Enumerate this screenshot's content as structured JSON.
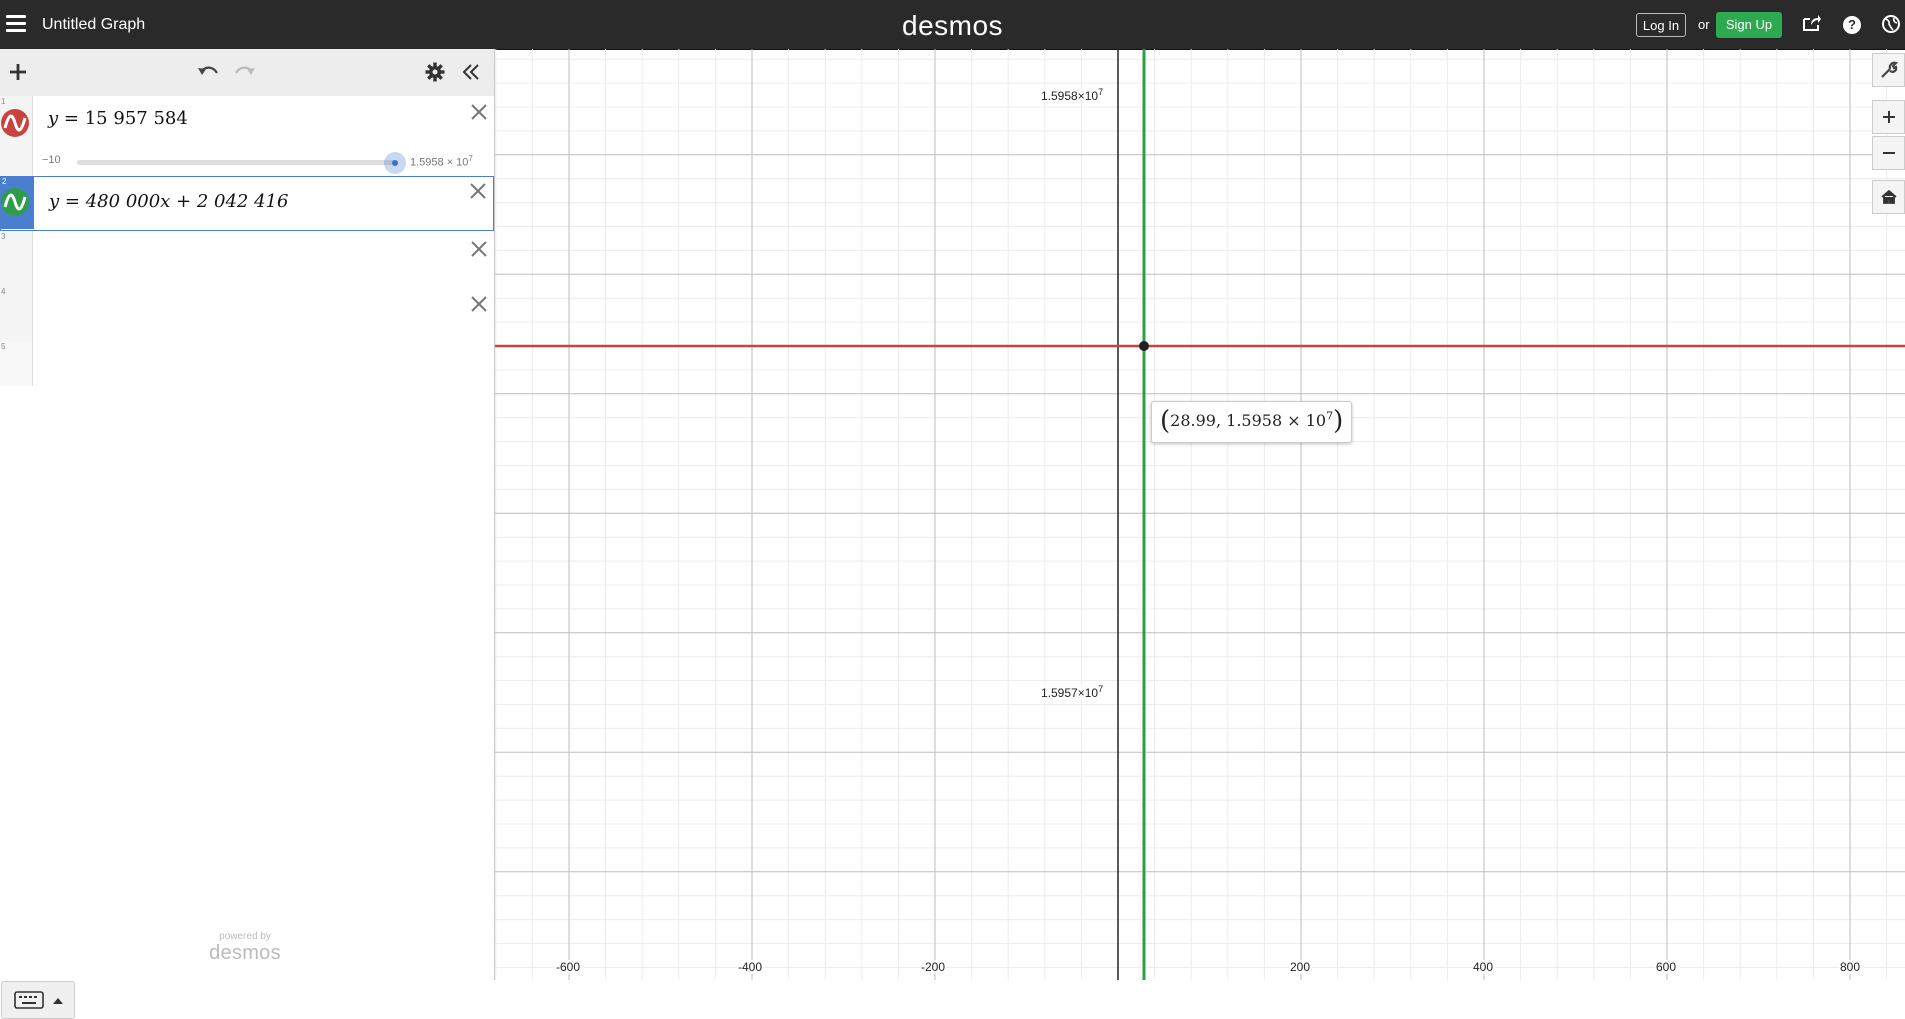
{
  "app": {
    "graph_title": "Untitled Graph",
    "logo": "desmos",
    "login_label": "Log In",
    "or_label": "or",
    "signup_label": "Sign Up"
  },
  "icons": {
    "menu": "hamburger-menu-icon",
    "share": "share-icon",
    "help": "help-icon",
    "language": "globe-icon",
    "add": "plus-icon",
    "undo": "undo-icon",
    "redo": "redo-icon",
    "settings": "gear-icon",
    "collapse": "double-chevron-left-icon",
    "graph_settings": "wrench-icon",
    "zoom_in": "plus-icon",
    "zoom_out": "minus-icon",
    "home": "home-icon",
    "keyboard": "keyboard-icon"
  },
  "colors": {
    "red": "#c74440",
    "green": "#2d9d4b",
    "blue_select": "#4a7fd0",
    "topbar": "#2a2a2a",
    "signup": "#2da94f"
  },
  "expressions": [
    {
      "number": "1",
      "lhs": "y",
      "eq": "=",
      "rhs": "15 957 584",
      "color": "#c74440",
      "slider": {
        "min": "−10",
        "max_mantissa": "1.5958 × 10",
        "max_exp": "7"
      }
    },
    {
      "number": "2",
      "lhs": "y",
      "eq": "=",
      "rhs": "480 000x + 2 042 416",
      "color": "#2d9d4b"
    },
    {
      "number": "3"
    },
    {
      "number": "4"
    },
    {
      "number": "5"
    }
  ],
  "footer": {
    "powered_by": "powered by",
    "brand": "desmos"
  },
  "graph": {
    "y_labels": [
      {
        "mantissa": "1.5958×10",
        "exp": "7"
      },
      {
        "mantissa": "1.5957×10",
        "exp": "7"
      }
    ],
    "x_labels": [
      "-600",
      "-400",
      "-200",
      "200",
      "400",
      "600",
      "800"
    ],
    "tooltip": {
      "x": "28.99",
      "y_mantissa": "1.5958 × 10",
      "y_exp": "7"
    }
  }
}
